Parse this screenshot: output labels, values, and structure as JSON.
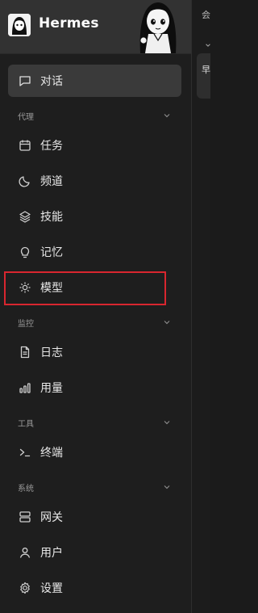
{
  "app": {
    "name": "Hermes"
  },
  "nav": {
    "chat": "对话",
    "sections": {
      "agent": "代理",
      "monitor": "监控",
      "tools": "工具",
      "system": "系统"
    },
    "items": {
      "tasks": "任务",
      "channels": "频道",
      "skills": "技能",
      "memory": "记忆",
      "models": "模型",
      "logs": "日志",
      "usage": "用量",
      "terminal": "终端",
      "gateway": "网关",
      "users": "用户",
      "settings": "设置"
    }
  },
  "right_pane": {
    "label": "会",
    "card_text": "早"
  },
  "colors": {
    "highlight": "#d8262f",
    "active_bg": "#3a3a3a"
  }
}
